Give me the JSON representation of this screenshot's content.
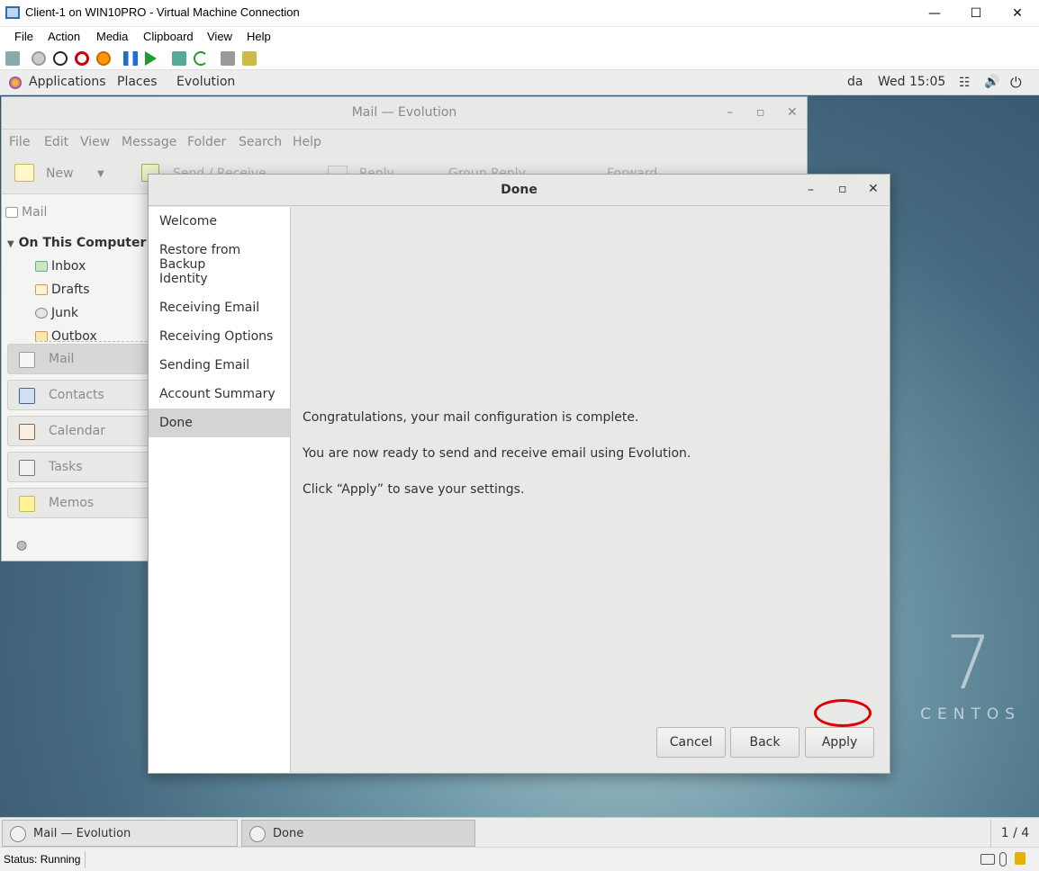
{
  "host": {
    "title": "Client-1 on WIN10PRO - Virtual Machine Connection",
    "menu": [
      "File",
      "Action",
      "Media",
      "Clipboard",
      "View",
      "Help"
    ],
    "status": "Status: Running"
  },
  "gnome": {
    "applications": "Applications",
    "places": "Places",
    "app_menu": "Evolution",
    "input_lang": "da",
    "clock": "Wed 15:05",
    "workspace": "1 / 4",
    "tasks": [
      "Mail — Evolution",
      "Done"
    ]
  },
  "evolution": {
    "title": "Mail — Evolution",
    "menu": [
      "File",
      "Edit",
      "View",
      "Message",
      "Folder",
      "Search",
      "Help"
    ],
    "toolbar": {
      "new": "New",
      "send_receive": "Send / Receive",
      "reply": "Reply",
      "group_reply": "Group Reply",
      "forward": "Forward"
    },
    "section": "Mail",
    "account": "On This Computer",
    "folders": [
      "Inbox",
      "Drafts",
      "Junk",
      "Outbox"
    ],
    "switcher": [
      "Mail",
      "Contacts",
      "Calendar",
      "Tasks",
      "Memos"
    ]
  },
  "dialog": {
    "title": "Done",
    "steps": [
      "Welcome",
      "Restore from Backup",
      "Identity",
      "Receiving Email",
      "Receiving Options",
      "Sending Email",
      "Account Summary",
      "Done"
    ],
    "active_step": "Done",
    "messages": [
      "Congratulations, your mail configuration is complete.",
      "You are now ready to send and receive email using Evolution.",
      "Click “Apply” to save your settings."
    ],
    "buttons": {
      "cancel": "Cancel",
      "back": "Back",
      "apply": "Apply"
    }
  },
  "branding": {
    "version": "7",
    "word": "CENTOS"
  },
  "colors": {
    "highlight_ring": "#e00000",
    "accent": "#2a6db5"
  }
}
